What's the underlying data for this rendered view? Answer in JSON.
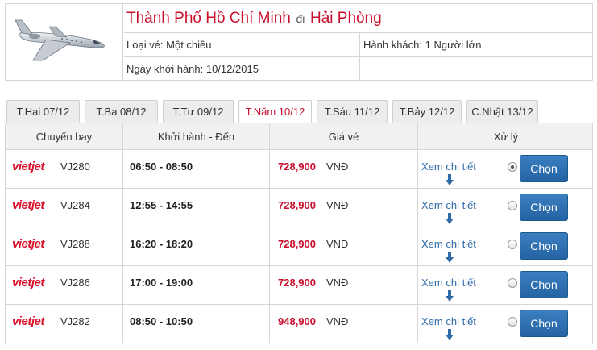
{
  "header": {
    "origin": "Thành Phố Hồ Chí Minh",
    "separator": "đi",
    "destination": "Hải Phòng",
    "ticket_type": "Loại vé: Một chiều",
    "passengers": "Hành khách: 1 Người lớn",
    "departure_date": "Ngày khởi hành: 10/12/2015"
  },
  "tabs": [
    {
      "label": "T.Hai 07/12",
      "active": false
    },
    {
      "label": "T.Ba 08/12",
      "active": false
    },
    {
      "label": "T.Tư 09/12",
      "active": false
    },
    {
      "label": "T.Năm 10/12",
      "active": true
    },
    {
      "label": "T.Sáu 11/12",
      "active": false
    },
    {
      "label": "T.Bảy 12/12",
      "active": false
    },
    {
      "label": "C.Nhật 13/12",
      "active": false
    }
  ],
  "columns": {
    "flight": "Chuyến bay",
    "time": "Khởi hành - Đến",
    "price": "Giá vé",
    "action": "Xử lý"
  },
  "rows": [
    {
      "airline": "vietjet",
      "flight": "VJ280",
      "time": "06:50 - 08:50",
      "price": "728,900",
      "currency": "VNĐ",
      "detail": "Xem chi tiết",
      "selected": true,
      "choose": "Chọn"
    },
    {
      "airline": "vietjet",
      "flight": "VJ284",
      "time": "12:55 - 14:55",
      "price": "728,900",
      "currency": "VNĐ",
      "detail": "Xem chi tiết",
      "selected": false,
      "choose": "Chọn"
    },
    {
      "airline": "vietjet",
      "flight": "VJ288",
      "time": "16:20 - 18:20",
      "price": "728,900",
      "currency": "VNĐ",
      "detail": "Xem chi tiết",
      "selected": false,
      "choose": "Chọn"
    },
    {
      "airline": "vietjet",
      "flight": "VJ286",
      "time": "17:00 - 19:00",
      "price": "728,900",
      "currency": "VNĐ",
      "detail": "Xem chi tiết",
      "selected": false,
      "choose": "Chọn"
    },
    {
      "airline": "vietjet",
      "flight": "VJ282",
      "time": "08:50 - 10:50",
      "price": "948,900",
      "currency": "VNĐ",
      "detail": "Xem chi tiết",
      "selected": false,
      "choose": "Chọn"
    }
  ],
  "colors": {
    "accent_red": "#c8102e",
    "link_blue": "#2f6aa8",
    "button_blue": "#2563a3"
  },
  "icons": {
    "plane": "airplane-icon",
    "arrow": "arrow-down-icon"
  }
}
